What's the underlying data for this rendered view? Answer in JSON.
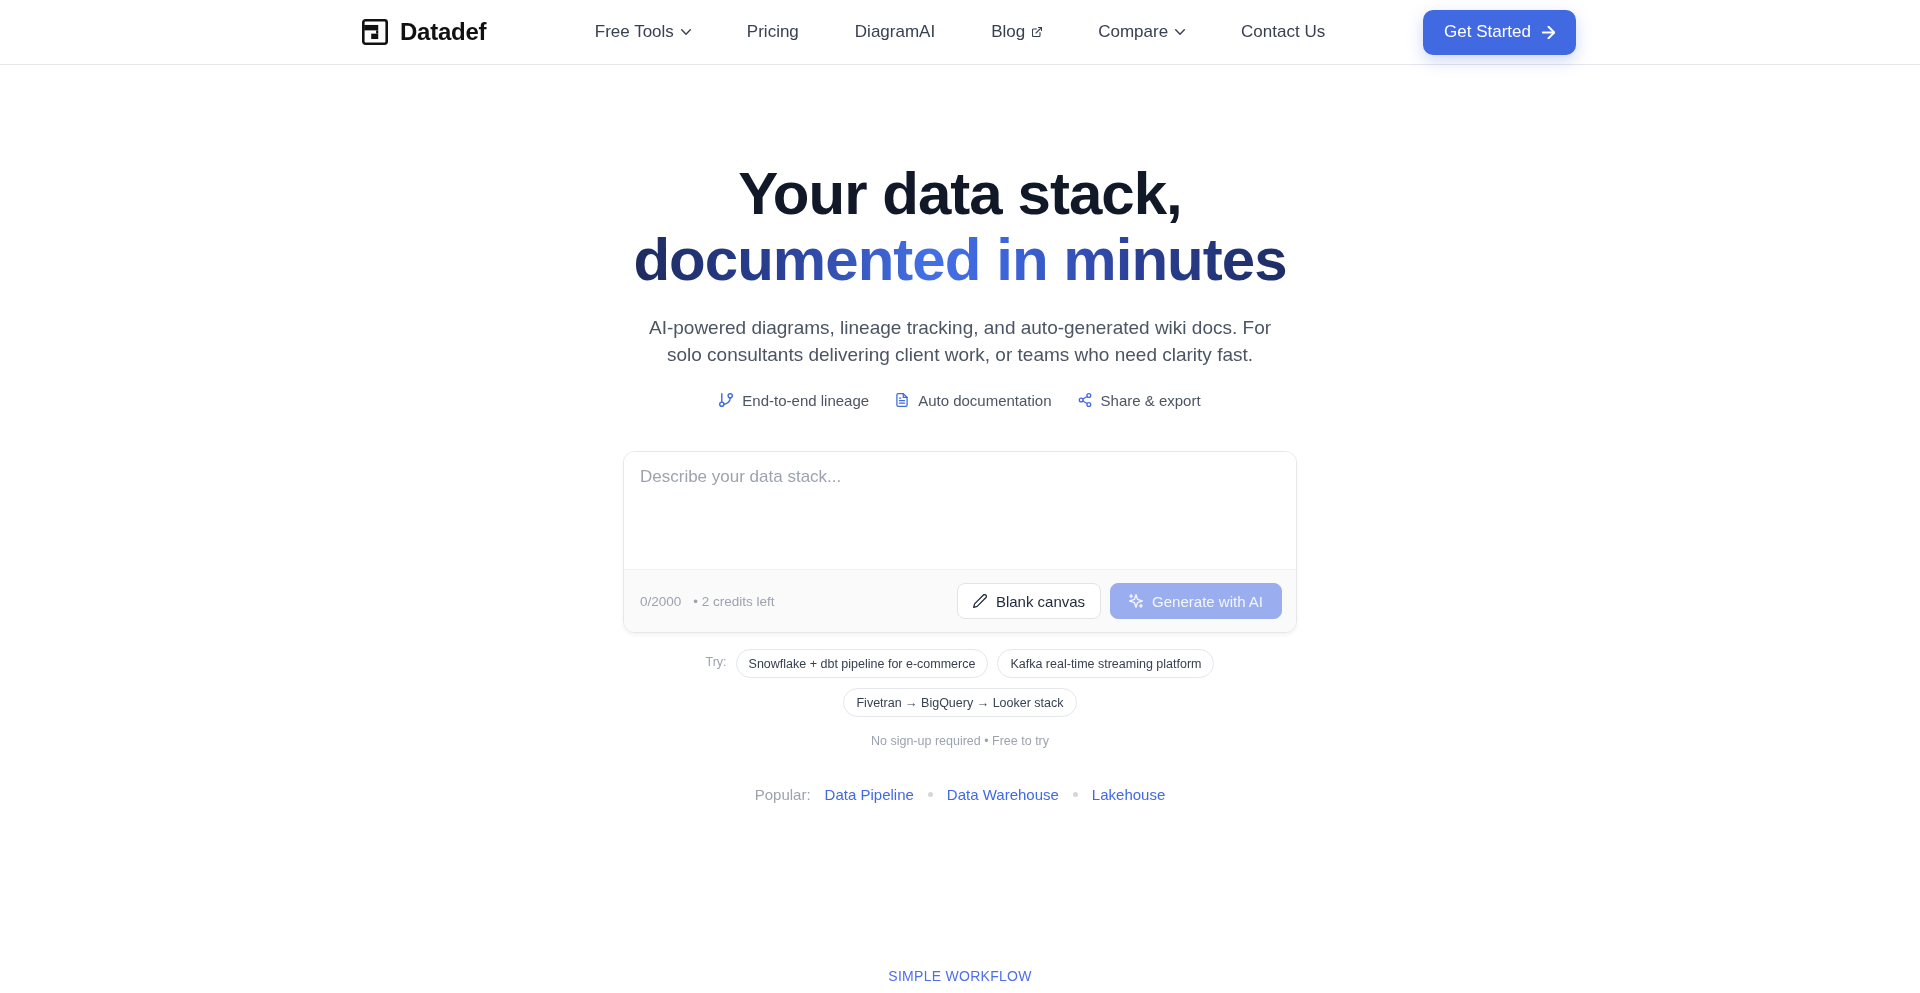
{
  "nav": {
    "logo": "Datadef",
    "links": [
      {
        "label": "Free Tools",
        "kind": "dropdown"
      },
      {
        "label": "Pricing",
        "kind": "link"
      },
      {
        "label": "DiagramAI",
        "kind": "link"
      },
      {
        "label": "Blog",
        "kind": "external"
      },
      {
        "label": "Compare",
        "kind": "dropdown"
      },
      {
        "label": "Contact Us",
        "kind": "link"
      }
    ],
    "cta": "Get Started"
  },
  "hero": {
    "heading": "Your data stack,",
    "heading_accent": "documented in minutes",
    "subtitle": "AI-powered diagrams, lineage tracking, and auto-generated wiki docs. For solo consultants delivering client work, or teams who need clarity fast.",
    "features": [
      {
        "label": "End-to-end lineage",
        "kind": "branch"
      },
      {
        "label": "Auto documentation",
        "kind": "document"
      },
      {
        "label": "Share & export",
        "kind": "share"
      }
    ]
  },
  "prompt": {
    "placeholder": "Describe your data stack...",
    "char_count": "0/2000",
    "credits": "• 2 credits left",
    "buttons": [
      {
        "label": "Blank canvas",
        "kind": "pencil",
        "disabled": false
      },
      {
        "label": "Generate with AI",
        "kind": "sparkle",
        "disabled": true
      }
    ]
  },
  "suggestions": {
    "label": "Try:",
    "chips": [
      "Snowflake + dbt pipeline for e-commerce",
      "Kafka real-time streaming platform",
      "Fivetran → BigQuery → Looker stack"
    ]
  },
  "note": "No sign-up required • Free to try",
  "popular": {
    "label": "Popular:",
    "links": [
      "Data Pipeline",
      "Data Warehouse",
      "Lakehouse"
    ]
  },
  "section_eyebrow": "SIMPLE WORKFLOW"
}
